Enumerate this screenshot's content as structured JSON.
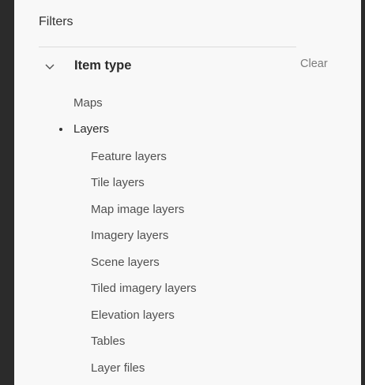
{
  "panel": {
    "title": "Filters"
  },
  "section": {
    "title": "Item type",
    "clear_label": "Clear",
    "expanded": true
  },
  "items": [
    {
      "label": "Maps",
      "level": 1,
      "selected": false
    },
    {
      "label": "Layers",
      "level": 1,
      "selected": true
    },
    {
      "label": "Feature layers",
      "level": 2,
      "selected": false
    },
    {
      "label": "Tile layers",
      "level": 2,
      "selected": false
    },
    {
      "label": "Map image layers",
      "level": 2,
      "selected": false
    },
    {
      "label": "Imagery layers",
      "level": 2,
      "selected": false
    },
    {
      "label": "Scene layers",
      "level": 2,
      "selected": false
    },
    {
      "label": "Tiled imagery layers",
      "level": 2,
      "selected": false
    },
    {
      "label": "Elevation layers",
      "level": 2,
      "selected": false
    },
    {
      "label": "Tables",
      "level": 2,
      "selected": false
    },
    {
      "label": "Layer files",
      "level": 2,
      "selected": false
    }
  ],
  "colors": {
    "background": "#2b2b2b",
    "panel": "#f8f8f8",
    "text": "#505050",
    "heading": "#2b2b2b",
    "muted": "#7a7a7a"
  }
}
